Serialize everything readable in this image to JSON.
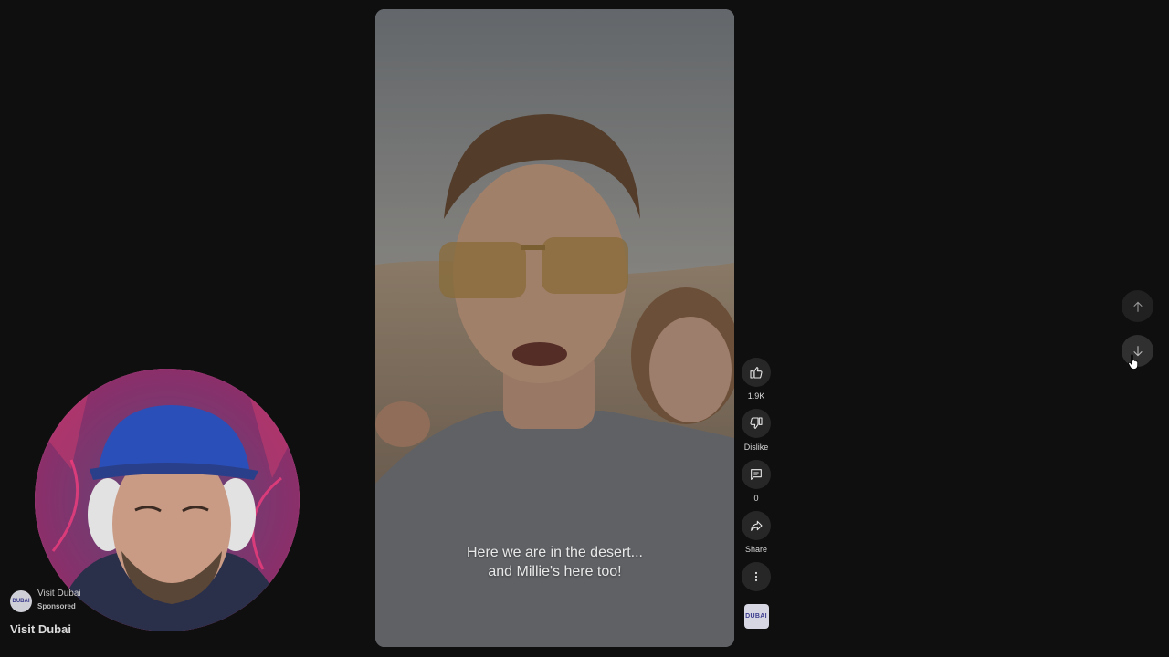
{
  "video": {
    "caption_line1": "Here we are in the desert...",
    "caption_line2": "and Millie's here too!"
  },
  "actions": {
    "like_count": "1.9K",
    "dislike_label": "Dislike",
    "comment_count": "0",
    "share_label": "Share",
    "channel_logo_text": "DUBAI"
  },
  "navigation": {
    "previous_icon": "arrow-up-icon",
    "next_icon": "arrow-down-icon"
  },
  "sponsor": {
    "channel_name": "Visit Dubai",
    "tag": "Sponsored",
    "title": "Visit Dubai",
    "avatar_text": "DUBAI"
  },
  "colors": {
    "background": "#0f0f0f",
    "button_bg": "#272727",
    "webcam_ring": "#f56aa8"
  }
}
